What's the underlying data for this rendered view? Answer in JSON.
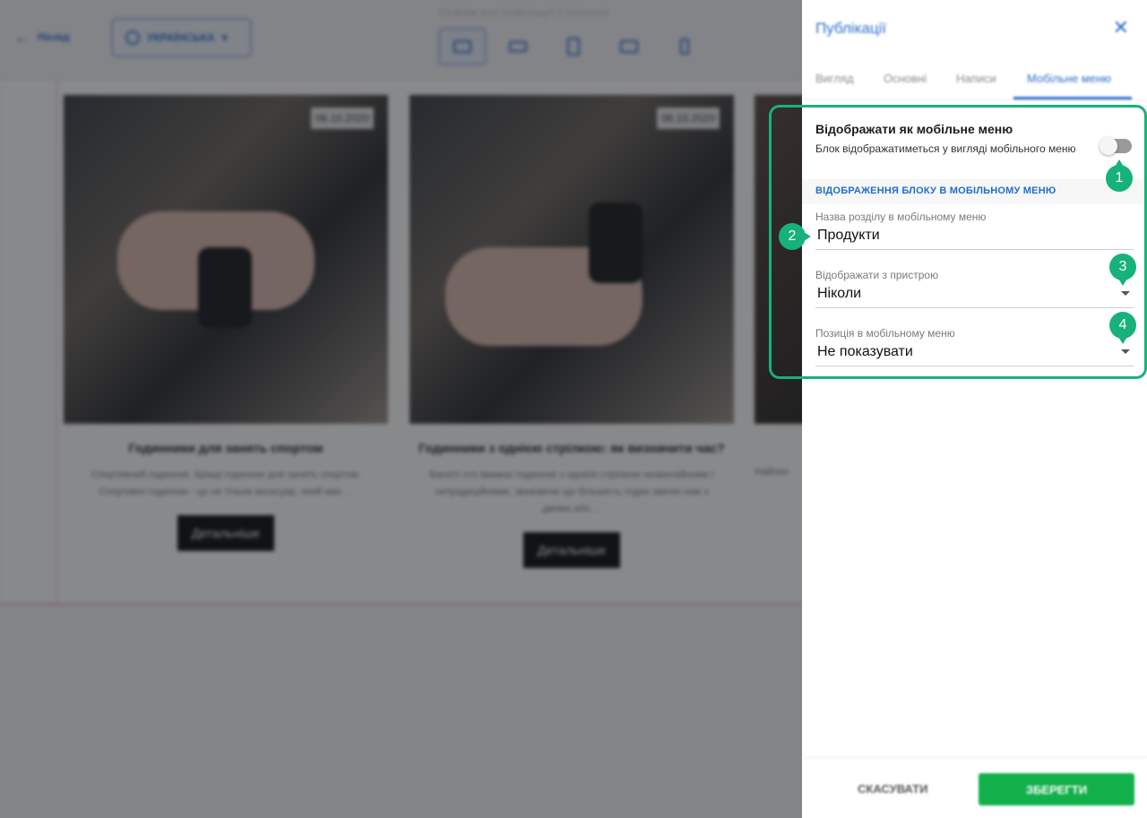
{
  "editor": {
    "back_label": "Назад",
    "language_label": "УКРАЇНСЬКА",
    "mode_label": "РЕЖИМ КАСТОМІЗАЦІЇ СТОРІНКИ",
    "cards": [
      {
        "date": "06.10.2020",
        "title": "Годинники для занять спортом",
        "description": "Спортивний годинник. Кращі годинник для занять спортом. Спортивні годинник - це не тільки аксесуар, який має ...",
        "button": "Детальніше"
      },
      {
        "date": "06.10.2020",
        "title": "Годинники з однією стрілкою: як визначити час?",
        "description": "Багато хто вважає годинник з однією стрілкою незвичайними і нетрадиційними, зважаючи що більшість годин звичні нам з двома або ...",
        "button": "Детальніше"
      },
      {
        "description": "Найпоп"
      }
    ]
  },
  "panel": {
    "title": "Публікації",
    "tabs": [
      "Вигляд",
      "Основні",
      "Написи",
      "Мобільне меню"
    ],
    "active_tab": "Мобільне меню",
    "mobile_menu": {
      "toggle_title": "Відображати як мобільне меню",
      "toggle_description": "Блок відображатиметься у вигляді мобільного меню",
      "toggle_on": false,
      "section_heading": "ВІДОБРАЖЕННЯ БЛОКУ В МОБІЛЬНОМУ МЕНЮ",
      "name_field": {
        "label": "Назва розділу в мобільному меню",
        "value": "Продукти"
      },
      "device_field": {
        "label": "Відображати з пристрою",
        "value": "Ніколи"
      },
      "position_field": {
        "label": "Позиція в мобільному меню",
        "value": "Не показувати"
      }
    },
    "cancel_label": "СКАСУВАТИ",
    "save_label": "ЗБЕРЕГТИ"
  },
  "markers": [
    "1",
    "2",
    "3",
    "4"
  ],
  "colors": {
    "accent_blue": "#2f6fd1",
    "highlight_green": "#16b27a",
    "save_green": "#12b04b"
  }
}
